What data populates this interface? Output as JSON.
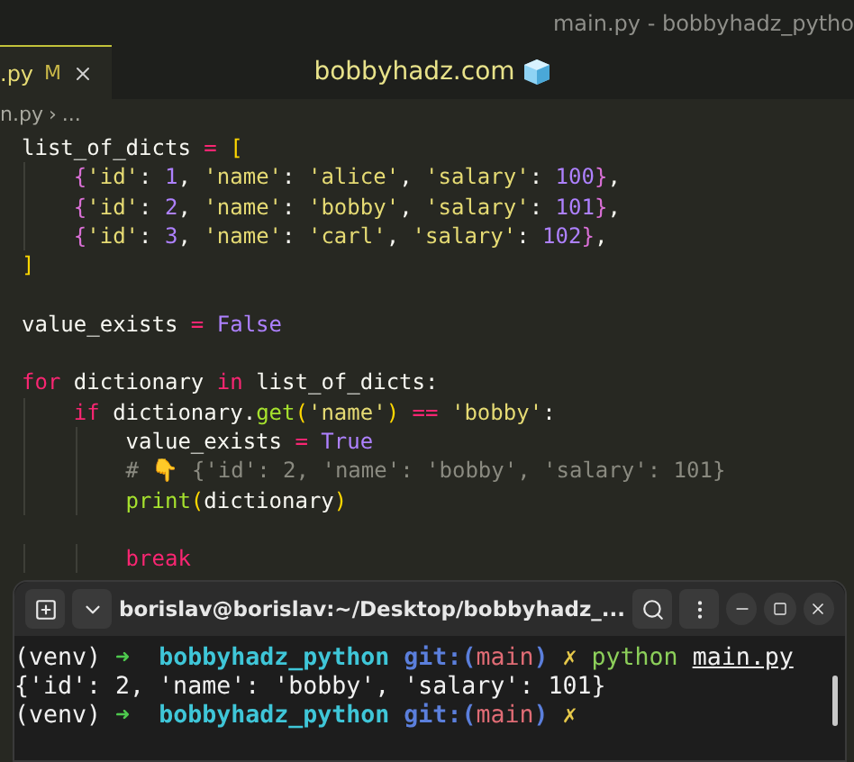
{
  "window": {
    "title": "main.py - bobbyhadz_pytho"
  },
  "editor_tab": {
    "label": ".py",
    "status": "M",
    "selected": true
  },
  "banner": {
    "text": "bobbyhadz.com"
  },
  "breadcrumb": {
    "file": "n.py",
    "separator": "›",
    "rest": "..."
  },
  "code_lines": [
    {
      "kind": "code",
      "tokens": [
        {
          "text": "list_of_dicts ",
          "kind": "plain"
        },
        {
          "text": "= ",
          "kind": "operator"
        },
        {
          "text": "[",
          "kind": "bracket1"
        }
      ]
    },
    {
      "kind": "code",
      "tokens": [
        {
          "text": "    {",
          "kind": "bracket2"
        },
        {
          "text": "'id'",
          "kind": "string"
        },
        {
          "text": ": ",
          "kind": "plain"
        },
        {
          "text": "1",
          "kind": "number"
        },
        {
          "text": ", ",
          "kind": "plain"
        },
        {
          "text": "'name'",
          "kind": "string"
        },
        {
          "text": ": ",
          "kind": "plain"
        },
        {
          "text": "'alice'",
          "kind": "string"
        },
        {
          "text": ", ",
          "kind": "plain"
        },
        {
          "text": "'salary'",
          "kind": "string"
        },
        {
          "text": ": ",
          "kind": "plain"
        },
        {
          "text": "100",
          "kind": "number"
        },
        {
          "text": "}",
          "kind": "bracket2"
        },
        {
          "text": ",",
          "kind": "plain"
        }
      ]
    },
    {
      "kind": "code",
      "tokens": [
        {
          "text": "    {",
          "kind": "bracket2"
        },
        {
          "text": "'id'",
          "kind": "string"
        },
        {
          "text": ": ",
          "kind": "plain"
        },
        {
          "text": "2",
          "kind": "number"
        },
        {
          "text": ", ",
          "kind": "plain"
        },
        {
          "text": "'name'",
          "kind": "string"
        },
        {
          "text": ": ",
          "kind": "plain"
        },
        {
          "text": "'bobby'",
          "kind": "string"
        },
        {
          "text": ", ",
          "kind": "plain"
        },
        {
          "text": "'salary'",
          "kind": "string"
        },
        {
          "text": ": ",
          "kind": "plain"
        },
        {
          "text": "101",
          "kind": "number"
        },
        {
          "text": "}",
          "kind": "bracket2"
        },
        {
          "text": ",",
          "kind": "plain"
        }
      ]
    },
    {
      "kind": "code",
      "tokens": [
        {
          "text": "    {",
          "kind": "bracket2"
        },
        {
          "text": "'id'",
          "kind": "string"
        },
        {
          "text": ": ",
          "kind": "plain"
        },
        {
          "text": "3",
          "kind": "number"
        },
        {
          "text": ", ",
          "kind": "plain"
        },
        {
          "text": "'name'",
          "kind": "string"
        },
        {
          "text": ": ",
          "kind": "plain"
        },
        {
          "text": "'carl'",
          "kind": "string"
        },
        {
          "text": ", ",
          "kind": "plain"
        },
        {
          "text": "'salary'",
          "kind": "string"
        },
        {
          "text": ": ",
          "kind": "plain"
        },
        {
          "text": "102",
          "kind": "number"
        },
        {
          "text": "}",
          "kind": "bracket2"
        },
        {
          "text": ",",
          "kind": "plain"
        }
      ]
    },
    {
      "kind": "code",
      "tokens": [
        {
          "text": "]",
          "kind": "bracket1"
        }
      ]
    },
    {
      "kind": "blank"
    },
    {
      "kind": "code",
      "tokens": [
        {
          "text": "value_exists ",
          "kind": "plain"
        },
        {
          "text": "= ",
          "kind": "operator"
        },
        {
          "text": "False",
          "kind": "constant"
        }
      ]
    },
    {
      "kind": "blank"
    },
    {
      "kind": "code",
      "tokens": [
        {
          "text": "for",
          "kind": "keyword"
        },
        {
          "text": " dictionary ",
          "kind": "plain"
        },
        {
          "text": "in",
          "kind": "keyword"
        },
        {
          "text": " list_of_dicts:",
          "kind": "plain"
        }
      ]
    },
    {
      "kind": "code",
      "tokens": [
        {
          "text": "    if",
          "kind": "keyword"
        },
        {
          "text": " dictionary.",
          "kind": "plain"
        },
        {
          "text": "get",
          "kind": "function"
        },
        {
          "text": "(",
          "kind": "bracket1"
        },
        {
          "text": "'name'",
          "kind": "string"
        },
        {
          "text": ") ",
          "kind": "bracket1"
        },
        {
          "text": "== ",
          "kind": "operator"
        },
        {
          "text": "'bobby'",
          "kind": "string"
        },
        {
          "text": ":",
          "kind": "plain"
        }
      ]
    },
    {
      "kind": "code",
      "tokens": [
        {
          "text": "        value_exists ",
          "kind": "plain"
        },
        {
          "text": "= ",
          "kind": "operator"
        },
        {
          "text": "True",
          "kind": "constant"
        }
      ]
    },
    {
      "kind": "code",
      "tokens": [
        {
          "text": "        # 👇 {'id': 2, 'name': 'bobby', 'salary': 101}",
          "kind": "comment"
        }
      ]
    },
    {
      "kind": "code",
      "tokens": [
        {
          "text": "        print",
          "kind": "function"
        },
        {
          "text": "(",
          "kind": "bracket1"
        },
        {
          "text": "dictionary",
          "kind": "plain"
        },
        {
          "text": ")",
          "kind": "bracket1"
        }
      ]
    },
    {
      "kind": "blank"
    },
    {
      "kind": "code",
      "tokens": [
        {
          "text": "        break",
          "kind": "keyword"
        }
      ]
    }
  ],
  "terminal": {
    "title": "borislav@borislav:~/Desktop/bobbyhadz_...",
    "lines": [
      {
        "tokens": [
          {
            "text": "(venv) ",
            "kind": "text"
          },
          {
            "text": "➜  ",
            "kind": "arrow"
          },
          {
            "text": "bobbyhadz_python ",
            "kind": "dir"
          },
          {
            "text": "git:(",
            "kind": "git"
          },
          {
            "text": "main",
            "kind": "branch"
          },
          {
            "text": ") ",
            "kind": "git"
          },
          {
            "text": "✗ ",
            "kind": "dirty"
          },
          {
            "text": "python ",
            "kind": "command"
          },
          {
            "text": "main.py",
            "kind": "file"
          }
        ]
      },
      {
        "tokens": [
          {
            "text": "{'id': 2, 'name': 'bobby', 'salary': 101}",
            "kind": "text"
          }
        ]
      },
      {
        "tokens": [
          {
            "text": "(venv) ",
            "kind": "text"
          },
          {
            "text": "➜  ",
            "kind": "arrow"
          },
          {
            "text": "bobbyhadz_python ",
            "kind": "dir"
          },
          {
            "text": "git:(",
            "kind": "git"
          },
          {
            "text": "main",
            "kind": "branch"
          },
          {
            "text": ") ",
            "kind": "git"
          },
          {
            "text": "✗",
            "kind": "dirty"
          }
        ]
      }
    ]
  }
}
